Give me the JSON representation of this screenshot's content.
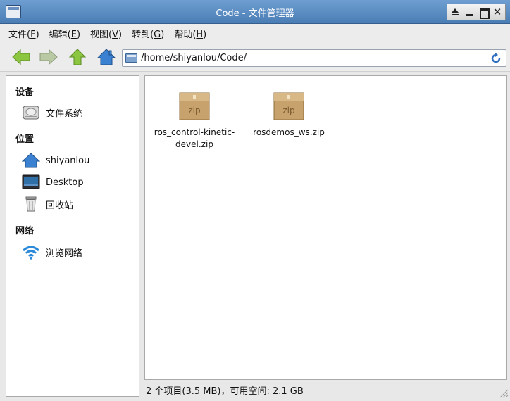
{
  "window": {
    "title": "Code - 文件管理器"
  },
  "menu": [
    {
      "label": "文件(",
      "key": "F",
      "suffix": ")"
    },
    {
      "label": "编辑(",
      "key": "E",
      "suffix": ")"
    },
    {
      "label": "视图(",
      "key": "V",
      "suffix": ")"
    },
    {
      "label": "转到(",
      "key": "G",
      "suffix": ")"
    },
    {
      "label": "帮助(",
      "key": "H",
      "suffix": ")"
    }
  ],
  "toolbar": {
    "address": "/home/shiyanlou/Code/"
  },
  "sidebar": {
    "devices_heading": "设备",
    "filesystem_label": "文件系统",
    "places_heading": "位置",
    "home_label": "shiyanlou",
    "desktop_label": "Desktop",
    "trash_label": "回收站",
    "network_heading": "网络",
    "browse_network_label": "浏览网络"
  },
  "files": [
    {
      "name": "ros_control-kinetic-devel.zip",
      "line1": "ros_control-kinetic-",
      "line2": "devel.zip",
      "badge": "zip"
    },
    {
      "name": "rosdemos_ws.zip",
      "line1": "rosdemos_ws.zip",
      "line2": "",
      "badge": "zip"
    }
  ],
  "status": {
    "text": "2 个项目(3.5 MB)，可用空间: 2.1 GB"
  },
  "colors": {
    "titlebar": "#4a7db5",
    "arrow_green": "#8cc640",
    "home_blue": "#3a82d1",
    "zip_brown": "#c8a26c"
  }
}
